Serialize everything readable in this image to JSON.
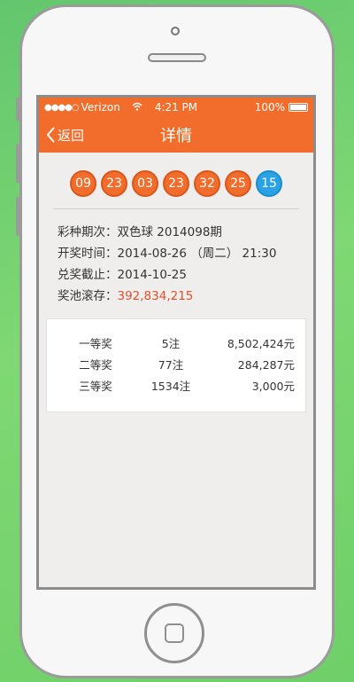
{
  "status_bar": {
    "carrier": "Verizon",
    "time": "4:21 PM",
    "battery": "100%"
  },
  "nav": {
    "back_label": "返回",
    "title": "详情"
  },
  "balls": [
    {
      "number": "09",
      "color": "red"
    },
    {
      "number": "23",
      "color": "red"
    },
    {
      "number": "03",
      "color": "red"
    },
    {
      "number": "23",
      "color": "red"
    },
    {
      "number": "32",
      "color": "red"
    },
    {
      "number": "25",
      "color": "red"
    },
    {
      "number": "15",
      "color": "blue"
    }
  ],
  "info": {
    "lottery_label": "彩种期次：",
    "lottery_value": "双色球 2014098期",
    "draw_time_label": "开奖时间：",
    "draw_time_value": "2014-08-26 （周二） 21:30",
    "deadline_label": "兑奖截止：",
    "deadline_value": "2014-10-25",
    "pool_label": "奖池滚存：",
    "pool_value": "392,834,215"
  },
  "prizes": [
    {
      "name": "一等奖",
      "count": "5注",
      "amount": "8,502,424元"
    },
    {
      "name": "二等奖",
      "count": "77注",
      "amount": "284,287元"
    },
    {
      "name": "三等奖",
      "count": "1534注",
      "amount": "3,000元"
    }
  ],
  "colors": {
    "brand_orange": "#f26d2b",
    "blue_ball": "#2aa3e6",
    "pool_highlight": "#e0502b",
    "background_green": "#6fcf68"
  }
}
